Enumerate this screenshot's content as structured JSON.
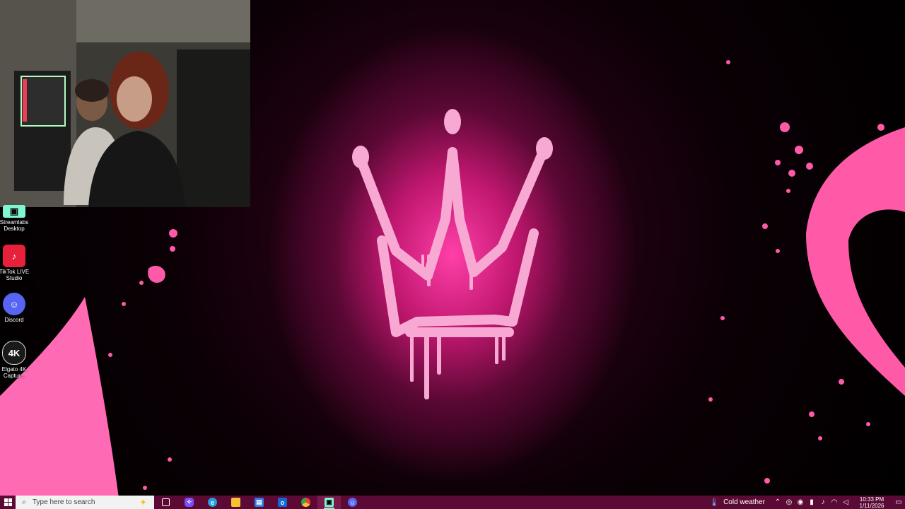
{
  "desktop_icons": [
    {
      "label": "Streamlabs Desktop",
      "icon": "streamlabs-icon",
      "color": "#80f5d2"
    },
    {
      "label": "TikTok LIVE Studio",
      "icon": "tiktok-live-icon",
      "color": "#e8203a"
    },
    {
      "label": "Discord",
      "icon": "discord-icon",
      "color": "#5865f2"
    },
    {
      "label": "Elgato 4K Captur...",
      "icon": "elgato-4k-icon",
      "color": "#1a1a1a",
      "glyph": "4K"
    }
  ],
  "taskbar": {
    "search_placeholder": "Type here to search",
    "apps": [
      {
        "name": "task-view-icon",
        "color": "#5a0a34"
      },
      {
        "name": "copilot-icon",
        "color": "#7a4cff"
      },
      {
        "name": "edge-icon",
        "color": "#1fa0e0"
      },
      {
        "name": "file-explorer-icon",
        "color": "#f6c22f"
      },
      {
        "name": "microsoft-store-icon",
        "color": "#2d7be6"
      },
      {
        "name": "outlook-icon",
        "color": "#1068d6"
      },
      {
        "name": "chrome-icon",
        "color": "#e84233"
      },
      {
        "name": "streamlabs-icon",
        "color": "#80f5d2"
      },
      {
        "name": "discord-icon",
        "color": "#5865f2"
      }
    ],
    "weather": "Cold weather",
    "time": "10:33 PM",
    "date": "1/11/2026",
    "accent": "#5a0a34"
  },
  "wallpaper": {
    "accent": "#ff5aa8"
  }
}
